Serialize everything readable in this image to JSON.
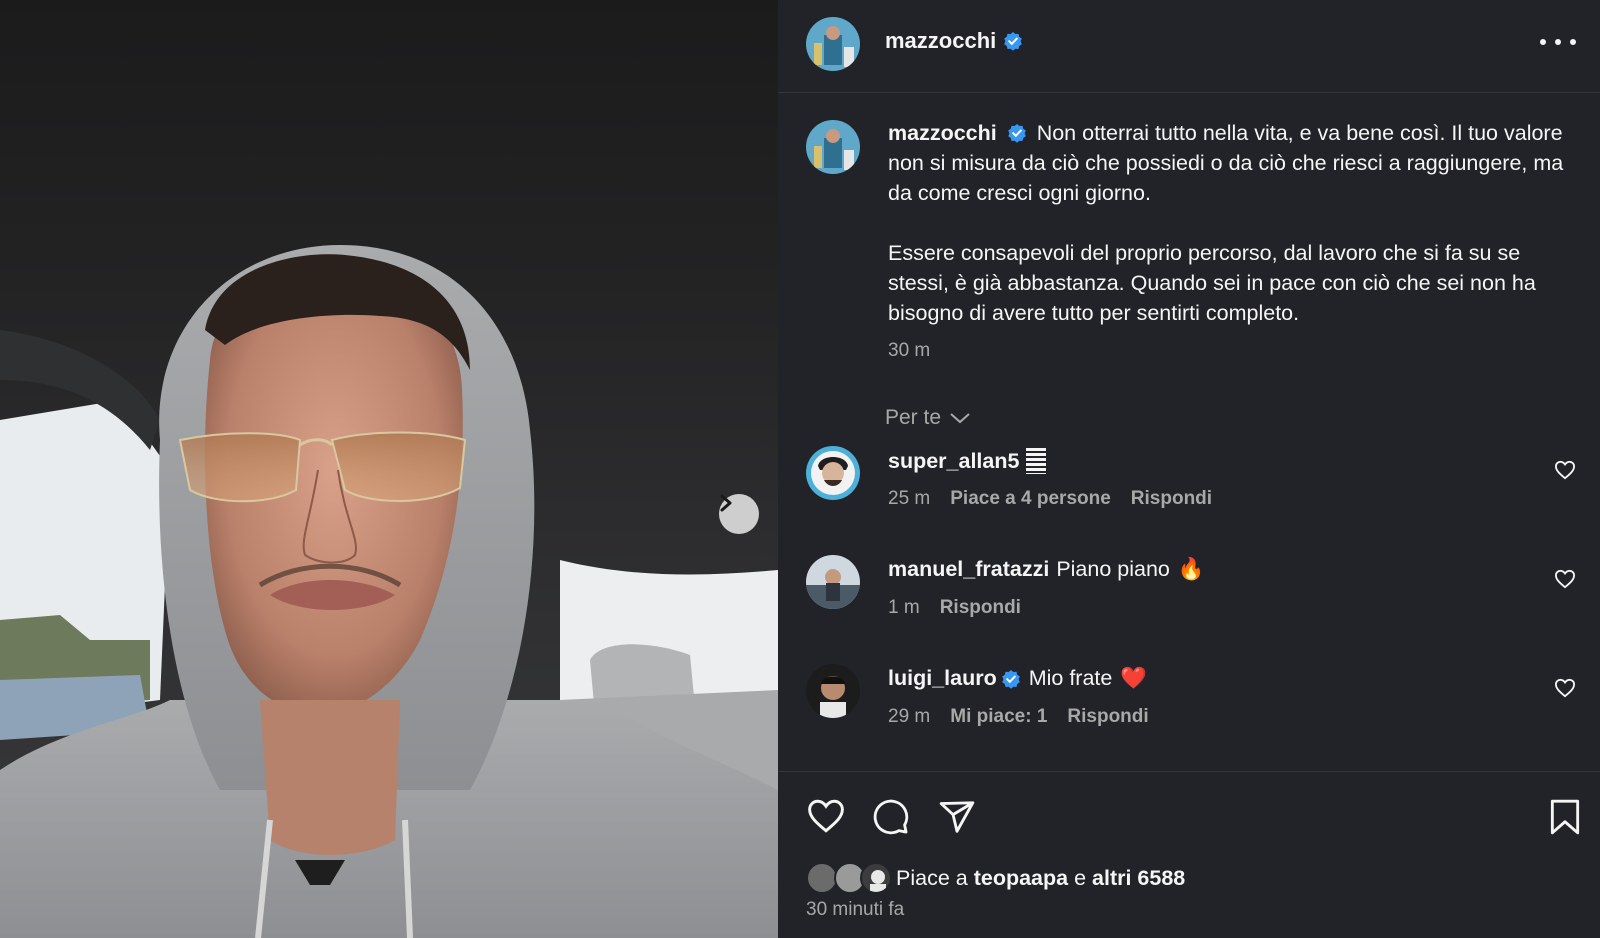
{
  "post": {
    "username": "mazzocchi",
    "caption_p1": "Non otterrai tutto nella vita, e va bene così. Il tuo valore non si misura da ciò che possiedi o da ciò che riesci a raggiungere, ma da come cresci ogni giorno.",
    "caption_p2": "Essere consapevoli del proprio percorso, dal lavoro che si fa su se stessi, è già abbastanza. Quando sei in pace con ciò che sei non ha bisogno di avere tutto per sentirti completo.",
    "caption_time": "30 m",
    "posted_ago": "30 minuti fa"
  },
  "filter": {
    "label": "Per te"
  },
  "comments": [
    {
      "username": "super_allan5",
      "text": "",
      "emoji": "🟰",
      "time": "25 m",
      "likes": "Piace a 4 persone",
      "reply": "Rispondi",
      "verified": false
    },
    {
      "username": "manuel_fratazzi",
      "text": "Piano piano",
      "emoji": "🔥",
      "time": "1 m",
      "likes": "",
      "reply": "Rispondi",
      "verified": false
    },
    {
      "username": "luigi_lauro",
      "text": "Mio frate",
      "emoji": "❤️",
      "time": "29 m",
      "likes": "Mi piace: 1",
      "reply": "Rispondi",
      "verified": true
    }
  ],
  "likes": {
    "prefix": "Piace a",
    "user": "teopaapa",
    "joiner": "e",
    "others": "altri 6588"
  },
  "colors": {
    "panel_bg": "#212328",
    "verified_blue": "#3897f0",
    "secondary_text": "#a8a8a8"
  },
  "icons": [
    "next-arrow-icon",
    "more-options-icon",
    "verified-badge-icon",
    "chevron-down-icon",
    "heart-icon",
    "comment-icon",
    "share-icon",
    "bookmark-icon"
  ]
}
